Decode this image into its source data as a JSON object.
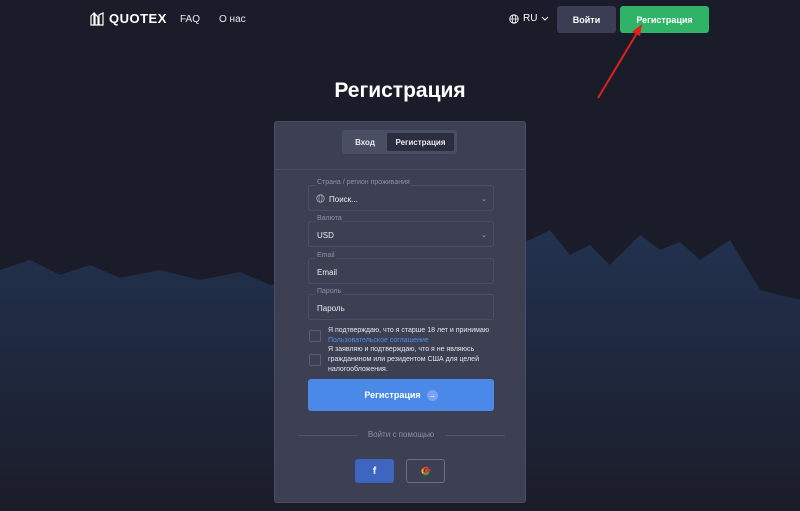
{
  "colors": {
    "background": "#1b1c29",
    "card": "#3c4052",
    "accent_green": "#2fb467",
    "accent_blue": "#4a89e8",
    "arrow": "#e0201c"
  },
  "header": {
    "logo_text": "QUOTEX",
    "nav": [
      "FAQ",
      "О нас"
    ],
    "lang": "RU",
    "login_label": "Войти",
    "register_label": "Регистрация"
  },
  "page": {
    "title": "Регистрация"
  },
  "form": {
    "tabs": {
      "login": "Вход",
      "register": "Регистрация"
    },
    "country": {
      "label": "Страна / регион проживания",
      "placeholder": "Поиск..."
    },
    "currency": {
      "label": "Валюта",
      "value": "USD"
    },
    "email": {
      "label": "Email",
      "placeholder": "Email"
    },
    "password": {
      "label": "Пароль",
      "placeholder": "Пароль"
    },
    "consent_age": "Я подтверждаю, что я старше 18 лет и принимаю",
    "consent_link": "Пользовательское соглашение",
    "consent_us": "Я заявляю и подтверждаю, что я не являюсь гражданином или резидентом США для целей налогообложения.",
    "submit_label": "Регистрация",
    "social_label": "Войти с помощью",
    "social": {
      "facebook": "f",
      "google": "G"
    }
  }
}
